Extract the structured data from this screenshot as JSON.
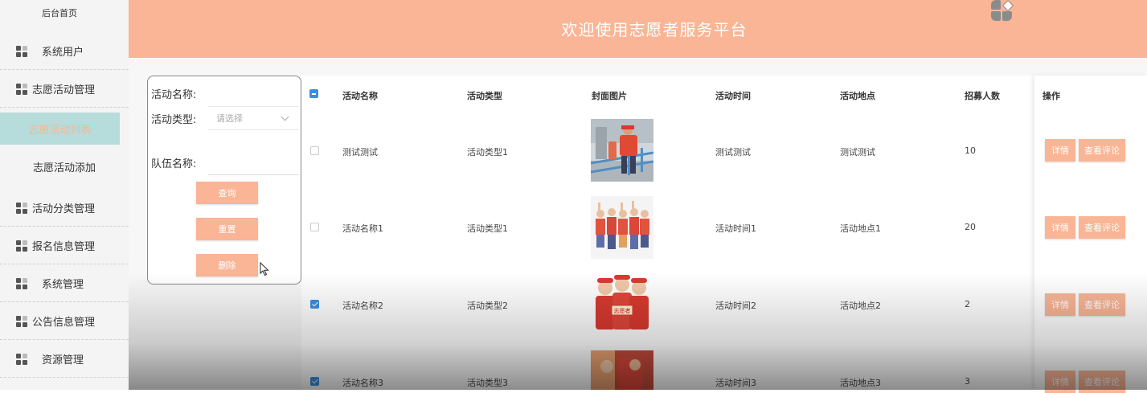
{
  "sidebar": {
    "home": "后台首页",
    "items": [
      {
        "label": "系统用户"
      },
      {
        "label": "志愿活动管理"
      },
      {
        "label": "活动分类管理"
      },
      {
        "label": "报名信息管理"
      },
      {
        "label": "系统管理"
      },
      {
        "label": "公告信息管理"
      },
      {
        "label": "资源管理"
      }
    ],
    "sub_items": [
      {
        "label": "志愿活动列表",
        "active": true
      },
      {
        "label": "志愿活动添加",
        "active": false
      }
    ]
  },
  "header": {
    "title": "欢迎使用志愿者服务平台"
  },
  "search": {
    "name_label": "活动名称:",
    "name_value": "",
    "type_label": "活动类型:",
    "type_placeholder": "请选择",
    "team_label": "队伍名称:",
    "team_value": "",
    "query_button": "查询",
    "reset_button": "重置",
    "delete_button": "删除"
  },
  "table": {
    "columns": [
      "活动名称",
      "活动类型",
      "封面图片",
      "活动时间",
      "活动地点",
      "招募人数",
      "操作"
    ],
    "rows": [
      {
        "name": "测试测试",
        "type": "活动类型1",
        "time": "测试测试",
        "location": "测试测试",
        "count": "10",
        "checked": false
      },
      {
        "name": "活动名称1",
        "type": "活动类型1",
        "time": "活动时间1",
        "location": "活动地点1",
        "count": "20",
        "checked": false
      },
      {
        "name": "活动名称2",
        "type": "活动类型2",
        "time": "活动时间2",
        "location": "活动地点2",
        "count": "2",
        "checked": true
      },
      {
        "name": "活动名称3",
        "type": "活动类型3",
        "time": "活动时间3",
        "location": "活动地点3",
        "count": "3",
        "checked": true
      }
    ],
    "detail_button": "详情",
    "comment_button": "查看评论",
    "image_badge_text": "志愿者"
  },
  "colors": {
    "accent": "#f9b596",
    "sidebar_active_bg": "#b7dcdc",
    "checkbox_blue": "#3b8fe0"
  }
}
